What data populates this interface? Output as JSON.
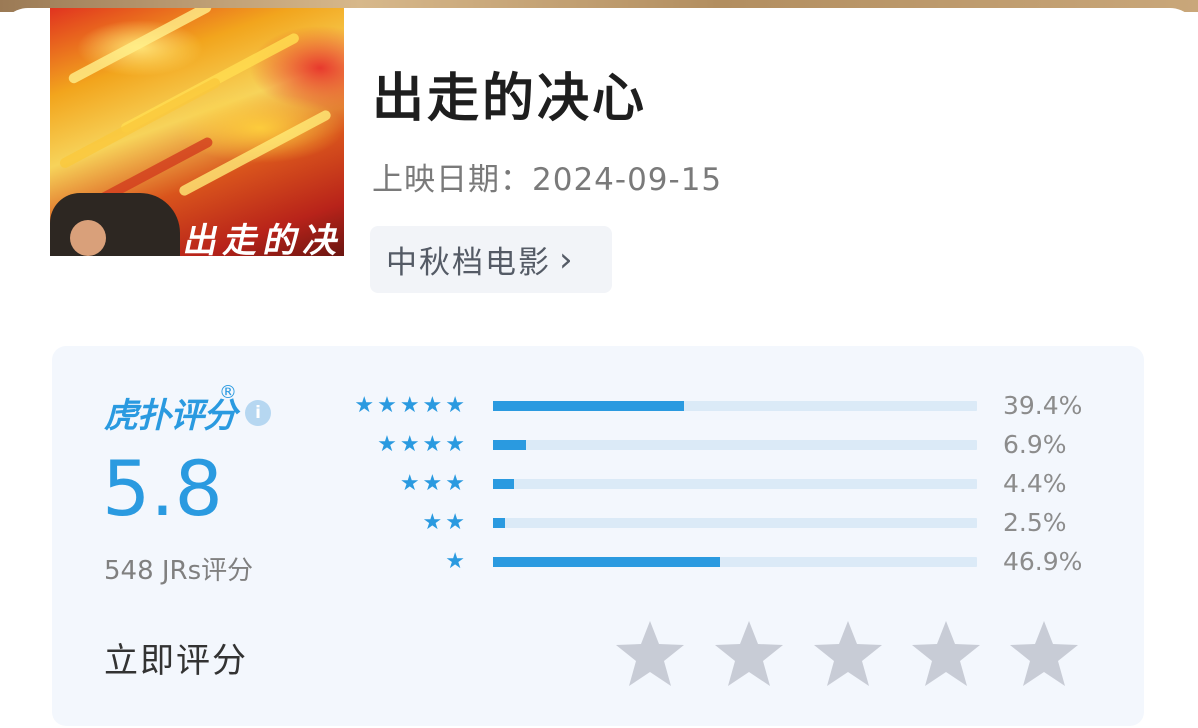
{
  "movie": {
    "title": "出走的决心",
    "release_label": "上映日期：",
    "release_date": "2024-09-15",
    "tag": "中秋档电影",
    "poster_title_text": "出走的决心"
  },
  "rating": {
    "brand": "虎扑评分",
    "brand_mark": "®",
    "info_icon": "i",
    "score": "5.8",
    "count_text": "548 JRs评分",
    "distribution": [
      {
        "stars": "★★★★★",
        "percent_text": "39.4%",
        "fraction": 0.394
      },
      {
        "stars": "★★★★",
        "percent_text": "6.9%",
        "fraction": 0.069
      },
      {
        "stars": "★★★",
        "percent_text": "4.4%",
        "fraction": 0.044
      },
      {
        "stars": "★★",
        "percent_text": "2.5%",
        "fraction": 0.025
      },
      {
        "stars": "★",
        "percent_text": "46.9%",
        "fraction": 0.469
      }
    ],
    "rate_now_label": "立即评分",
    "accent_color": "#2a9ae0",
    "empty_star_color": "#c8ccd6"
  },
  "icons": {
    "tag_chevron": "chevron-right-icon",
    "info": "info-icon",
    "star": "star-icon"
  }
}
